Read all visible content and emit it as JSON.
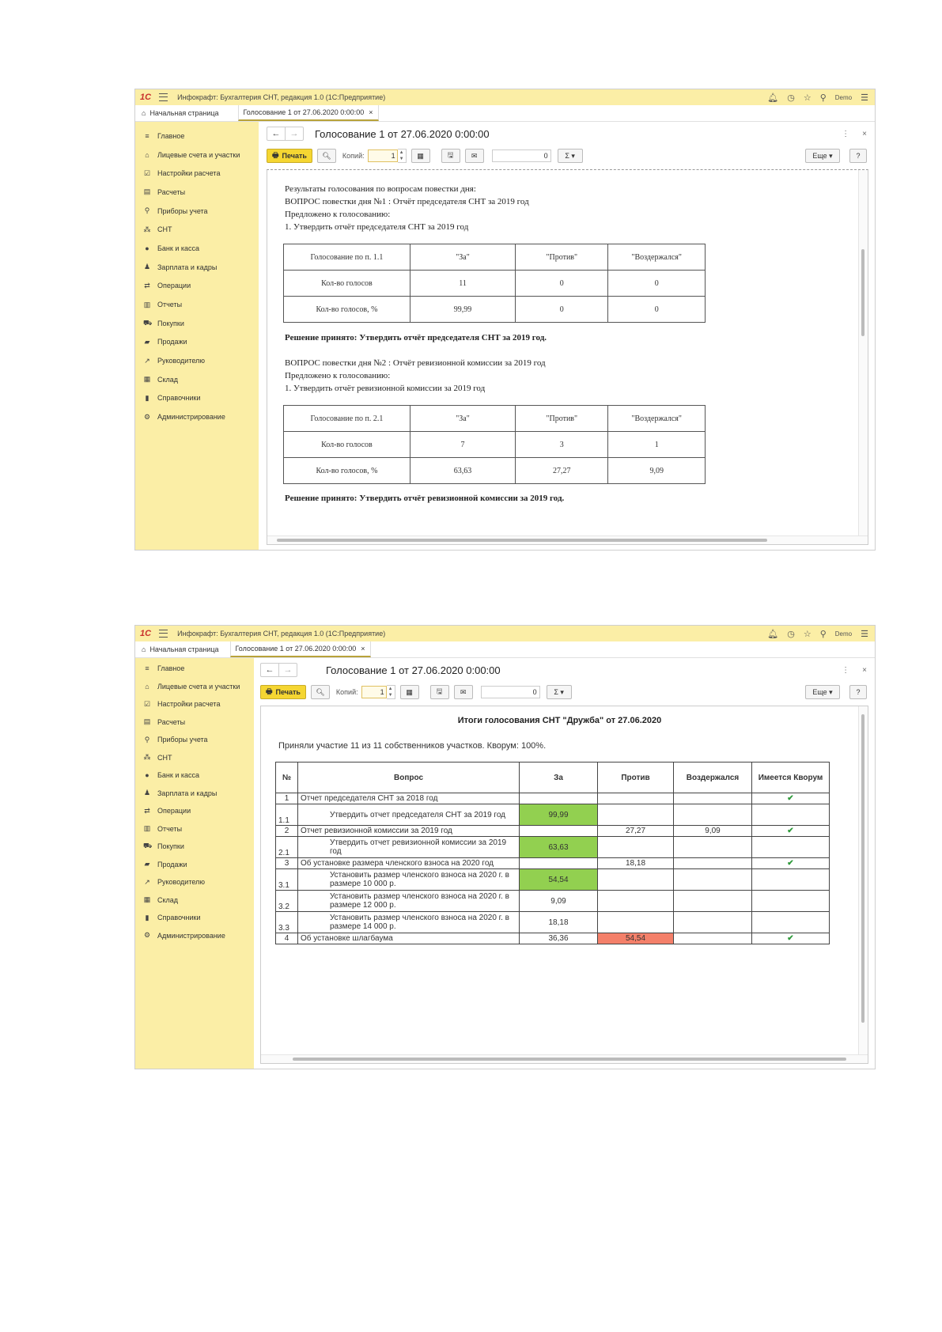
{
  "app": {
    "logo": "1С",
    "title": "Инфокрафт: Бухгалтерия СНТ, редакция 1.0  (1С:Предприятие)",
    "user": "Demo"
  },
  "tabs": {
    "home": "Начальная страница",
    "doc": "Голосование 1 от 27.06.2020 0:00:00"
  },
  "sidebar": [
    {
      "label": "Главное",
      "icon": "≡"
    },
    {
      "label": "Лицевые счета и участки",
      "icon": "⌂"
    },
    {
      "label": "Настройки расчета",
      "icon": "☑"
    },
    {
      "label": "Расчеты",
      "icon": "▤"
    },
    {
      "label": "Приборы учета",
      "icon": "⚲"
    },
    {
      "label": "СНТ",
      "icon": "⁂"
    },
    {
      "label": "Банк и касса",
      "icon": "●"
    },
    {
      "label": "Зарплата и кадры",
      "icon": "♟"
    },
    {
      "label": "Операции",
      "icon": "⇄"
    },
    {
      "label": "Отчеты",
      "icon": "▥"
    },
    {
      "label": "Покупки",
      "icon": "⛟"
    },
    {
      "label": "Продажи",
      "icon": "▰"
    },
    {
      "label": "Руководителю",
      "icon": "↗"
    },
    {
      "label": "Склад",
      "icon": "▦"
    },
    {
      "label": "Справочники",
      "icon": "▮"
    },
    {
      "label": "Администрирование",
      "icon": "⚙"
    }
  ],
  "doc": {
    "title": "Голосование 1 от 27.06.2020 0:00:00",
    "print": "Печать",
    "copies_label": "Копий:",
    "copies_value": "1",
    "sum_value": "0",
    "sigma": "Σ ▾",
    "more": "Еще ▾",
    "help": "?"
  },
  "report1": {
    "intro": "Результаты голосования по вопросам повестки дня:",
    "q1": "ВОПРОС повестки дня №1 : Отчёт председателя СНТ за 2019 год",
    "offered1": "Предложено к голосованию:",
    "item1": "1. Утвердить отчёт председателя СНТ за 2019 год",
    "table1": {
      "header": [
        "Голосование по п. 1.1",
        "\"За\"",
        "\"Против\"",
        "\"Воздержался\""
      ],
      "rows": [
        [
          "Кол-во голосов",
          "11",
          "0",
          "0"
        ],
        [
          "Кол-во голосов, %",
          "99,99",
          "0",
          "0"
        ]
      ]
    },
    "decision1": "Решение принято: Утвердить отчёт председателя СНТ за 2019 год.",
    "q2": "ВОПРОС повестки дня №2 : Отчёт ревизионной комиссии за 2019 год",
    "offered2": "Предложено к голосованию:",
    "item2": "1. Утвердить отчёт ревизионной комиссии за 2019 год",
    "table2": {
      "header": [
        "Голосование по п. 2.1",
        "\"За\"",
        "\"Против\"",
        "\"Воздержался\""
      ],
      "rows": [
        [
          "Кол-во голосов",
          "7",
          "3",
          "1"
        ],
        [
          "Кол-во голосов, %",
          "63,63",
          "27,27",
          "9,09"
        ]
      ]
    },
    "decision2": "Решение принято: Утвердить отчёт ревизионной комиссии за 2019 год."
  },
  "report2": {
    "title": "Итоги голосования СНТ \"Дружба\" от 27.06.2020",
    "summary": "Приняли участие 11 из 11 собственников участков. Кворум: 100%.",
    "headers": [
      "№",
      "Вопрос",
      "За",
      "Против",
      "Воздержался",
      "Имеется Кворум"
    ],
    "rows": [
      {
        "no": "1",
        "q": "Отчет председателя СНТ за 2018 год",
        "za": "",
        "pr": "",
        "vz": "",
        "quorum": "✔"
      },
      {
        "no": "1.1",
        "q": "Утвердить отчет председателя СНТ за 2019 год",
        "za": "99,99",
        "pr": "",
        "vz": "",
        "quorum": ""
      },
      {
        "no": "2",
        "q": "Отчет ревизионной комиссии за 2019 год",
        "za": "",
        "pr": "27,27",
        "vz": "9,09",
        "quorum": "✔"
      },
      {
        "no": "2.1",
        "q": "Утвердить отчет ревизионной комиссии за 2019 год",
        "za": "63,63",
        "pr": "",
        "vz": "",
        "quorum": ""
      },
      {
        "no": "3",
        "q": "Об установке размера членского взноса на 2020 год",
        "za": "",
        "pr": "18,18",
        "vz": "",
        "quorum": "✔"
      },
      {
        "no": "3.1",
        "q": "Установить размер членского взноса на 2020 г. в размере 10 000 р.",
        "za": "54,54",
        "pr": "",
        "vz": "",
        "quorum": ""
      },
      {
        "no": "3.2",
        "q": "Установить размер членского взноса на 2020 г. в размере 12 000 р.",
        "za": "9,09",
        "pr": "",
        "vz": "",
        "quorum": ""
      },
      {
        "no": "3.3",
        "q": "Установить размер членского взноса на 2020 г. в размере 14 000 р.",
        "za": "18,18",
        "pr": "",
        "vz": "",
        "quorum": ""
      },
      {
        "no": "4",
        "q": "Об установке шлагбаума",
        "za": "36,36",
        "pr": "54,54",
        "vz": "",
        "quorum": "✔"
      }
    ],
    "colors": {
      "highlight_green": "#92d050",
      "highlight_red": "#f4806a",
      "check": "#2e9a3a"
    }
  }
}
